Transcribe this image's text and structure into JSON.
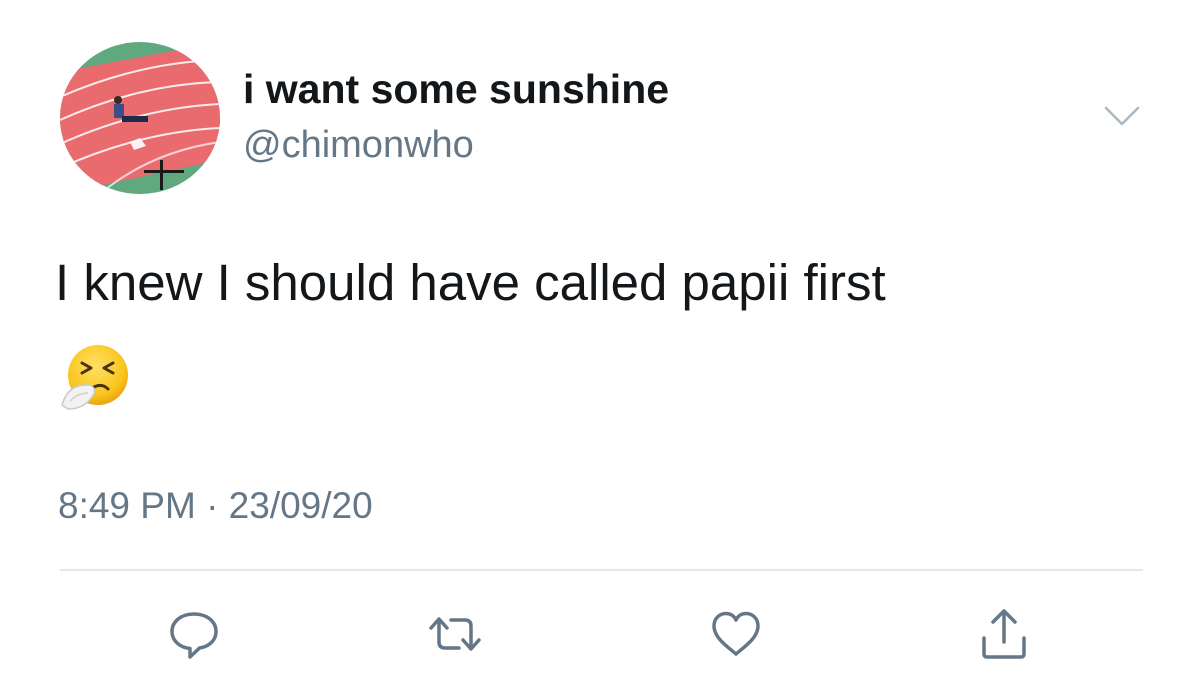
{
  "tweet": {
    "author": {
      "display_name": "i want some sunshine",
      "handle": "@chimonwho",
      "avatar_icon": "track-field-photo-avatar"
    },
    "text": "I knew I should have called papii first",
    "emoji": "🤧",
    "emoji_icon": "sneezing-face-icon",
    "timestamp": "8:49 PM · 23/09/20"
  },
  "actions": [
    {
      "name": "reply",
      "icon": "reply-icon"
    },
    {
      "name": "retweet",
      "icon": "retweet-icon"
    },
    {
      "name": "like",
      "icon": "heart-icon"
    },
    {
      "name": "share",
      "icon": "share-icon"
    }
  ],
  "colors": {
    "text_primary": "#14171a",
    "text_secondary": "#657786",
    "icon_gray": "#657786",
    "divider": "#e1e8ed",
    "avatar_track_red": "#e96b6e",
    "avatar_field_green": "#5fa880"
  }
}
